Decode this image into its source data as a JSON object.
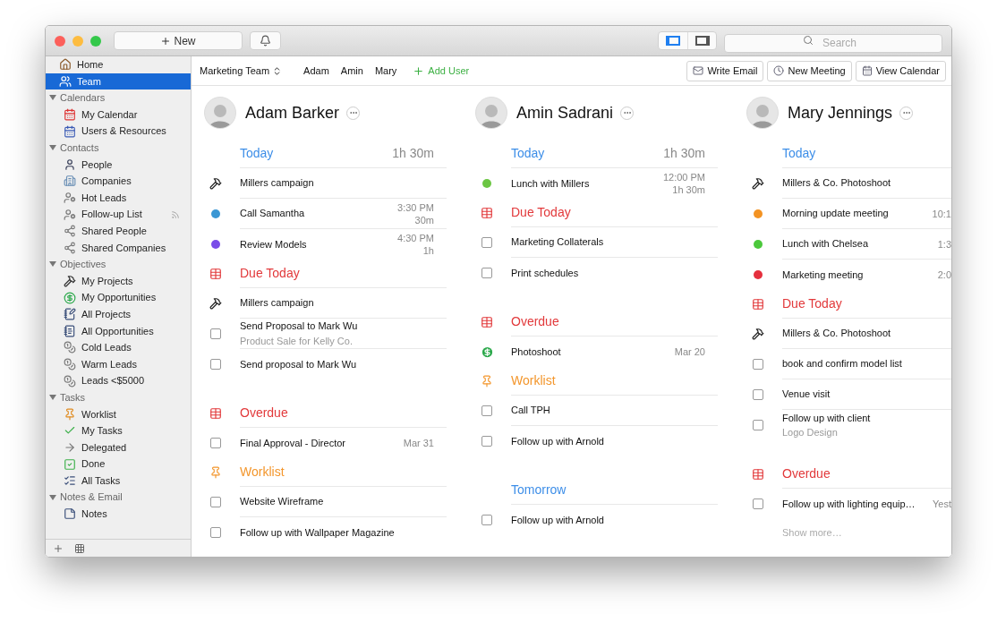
{
  "toolbar": {
    "new_button": "New",
    "view_toggle": [
      {
        "selected": true
      },
      {
        "selected": false
      }
    ],
    "search": {
      "placeholder": "Search"
    }
  },
  "sidebar": {
    "items": [
      {
        "label": "Home",
        "selected": false
      },
      {
        "label": "Team",
        "selected": true
      }
    ],
    "groups": [
      {
        "title": "Calendars",
        "expanded": true,
        "items": [
          {
            "label": "My Calendar",
            "selected": false
          },
          {
            "label": "Users & Resources",
            "selected": false
          }
        ]
      },
      {
        "title": "Contacts",
        "expanded": true,
        "items": [
          {
            "label": "People",
            "selected": false,
            "shared": false
          },
          {
            "label": "Companies",
            "selected": false,
            "shared": false
          },
          {
            "label": "Hot Leads",
            "selected": false,
            "shared": false
          },
          {
            "label": "Follow-up List",
            "selected": false,
            "shared": true
          },
          {
            "label": "Shared People",
            "selected": false,
            "shared": false
          },
          {
            "label": "Shared Companies",
            "selected": false,
            "shared": false
          }
        ]
      },
      {
        "title": "Objectives",
        "expanded": true,
        "items": [
          {
            "label": "My Projects",
            "selected": false
          },
          {
            "label": "My Opportunities",
            "selected": false
          },
          {
            "label": "All Projects",
            "selected": false
          },
          {
            "label": "All Opportunities",
            "selected": false
          },
          {
            "label": "Cold Leads",
            "selected": false
          },
          {
            "label": "Warm Leads",
            "selected": false
          },
          {
            "label": "Leads <$5000",
            "selected": false
          }
        ]
      },
      {
        "title": "Tasks",
        "expanded": true,
        "items": [
          {
            "label": "Worklist",
            "selected": false
          },
          {
            "label": "My Tasks",
            "selected": false
          },
          {
            "label": "Delegated",
            "selected": false
          },
          {
            "label": "Done",
            "selected": false
          },
          {
            "label": "All Tasks",
            "selected": false
          }
        ]
      },
      {
        "title": "Notes & Email",
        "expanded": true,
        "items": [
          {
            "label": "Notes",
            "selected": false
          }
        ]
      }
    ]
  },
  "team_bar": {
    "team": "Marketing Team",
    "users": [
      "Adam",
      "Amin",
      "Mary"
    ],
    "add_user": "Add User",
    "actions": [
      {
        "kind": "email",
        "label": "Write Email"
      },
      {
        "kind": "meeting",
        "label": "New Meeting"
      },
      {
        "kind": "calendar",
        "label": "View Calendar"
      }
    ]
  },
  "people": [
    {
      "name": "Adam Barker",
      "sections": [
        {
          "kind": "today",
          "title": "Today",
          "total": "1h 30m",
          "items": [
            {
              "kind": "project",
              "title": "Millers campaign"
            },
            {
              "kind": "event",
              "title": "Call Samantha",
              "color": "#3a97d4",
              "time": "3:30 PM",
              "duration": "30m"
            },
            {
              "kind": "event",
              "title": "Review Models",
              "color": "#7a4de8",
              "time": "4:30 PM",
              "duration": "1h"
            }
          ]
        },
        {
          "kind": "due",
          "title": "Due Today",
          "items": [
            {
              "kind": "project",
              "title": "Millers campaign"
            },
            {
              "kind": "task",
              "title": "Send Proposal to Mark Wu",
              "subtitle": "Product Sale for Kelly Co.",
              "checked": false
            },
            {
              "kind": "task",
              "title": "Send proposal to Mark Wu",
              "checked": false
            }
          ]
        },
        {
          "kind": "overdue",
          "title": "Overdue",
          "items": [
            {
              "kind": "task",
              "title": "Final Approval - Director",
              "date": "Mar 31",
              "checked": false
            }
          ]
        },
        {
          "kind": "worklist",
          "title": "Worklist",
          "items": [
            {
              "kind": "task",
              "title": "Website Wireframe",
              "checked": false
            },
            {
              "kind": "task",
              "title": "Follow up with Wallpaper Magazine",
              "checked": false
            }
          ]
        }
      ]
    },
    {
      "name": "Amin Sadrani",
      "sections": [
        {
          "kind": "today",
          "title": "Today",
          "total": "1h 30m",
          "items": [
            {
              "kind": "event",
              "title": "Lunch with Millers",
              "color": "#6cc644",
              "time": "12:00 PM",
              "duration": "1h 30m"
            }
          ]
        },
        {
          "kind": "due",
          "title": "Due Today",
          "items": [
            {
              "kind": "task",
              "title": "Marketing Collaterals",
              "checked": false
            },
            {
              "kind": "task",
              "title": "Print schedules",
              "checked": false
            }
          ]
        },
        {
          "kind": "overdue",
          "title": "Overdue",
          "items": [
            {
              "kind": "opportunity",
              "title": "Photoshoot",
              "date": "Mar 20"
            }
          ]
        },
        {
          "kind": "worklist",
          "title": "Worklist",
          "items": [
            {
              "kind": "task",
              "title": "Call TPH",
              "checked": false
            },
            {
              "kind": "task",
              "title": "Follow up with Arnold",
              "checked": false
            }
          ]
        },
        {
          "kind": "tomorrow",
          "title": "Tomorrow",
          "items": [
            {
              "kind": "task",
              "title": "Follow up with Arnold",
              "checked": false
            }
          ]
        }
      ]
    },
    {
      "name": "Mary Jennings",
      "sections": [
        {
          "kind": "today",
          "title": "Today",
          "items": [
            {
              "kind": "project",
              "title": "Millers & Co. Photoshoot"
            },
            {
              "kind": "event",
              "title": "Morning update meeting",
              "color": "#f39323",
              "time": "10:1"
            },
            {
              "kind": "event",
              "title": "Lunch with Chelsea",
              "color": "#4cc83c",
              "time": "1:3"
            },
            {
              "kind": "event",
              "title": "Marketing meeting",
              "color": "#e5303e",
              "time": "2:0"
            }
          ]
        },
        {
          "kind": "due",
          "title": "Due Today",
          "items": [
            {
              "kind": "project",
              "title": "Millers & Co. Photoshoot"
            },
            {
              "kind": "task",
              "title": "book and confirm model list",
              "checked": false
            },
            {
              "kind": "task",
              "title": "Venue visit",
              "checked": false
            },
            {
              "kind": "task",
              "title": "Follow up with client",
              "subtitle": "Logo Design",
              "checked": false
            }
          ]
        },
        {
          "kind": "overdue",
          "title": "Overdue",
          "items": [
            {
              "kind": "task",
              "title": "Follow up with lighting equip…",
              "date": "Yest",
              "checked": false
            }
          ],
          "more": "Show more…"
        }
      ]
    }
  ]
}
